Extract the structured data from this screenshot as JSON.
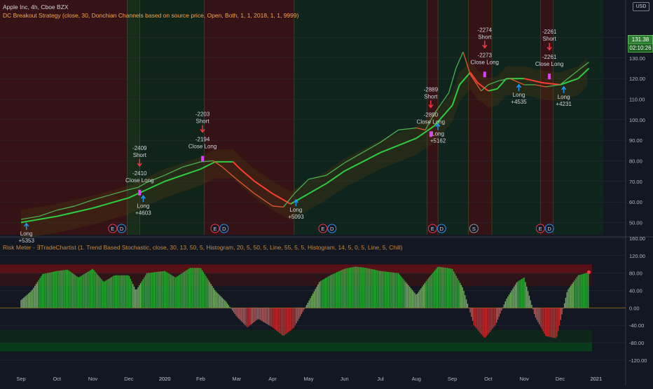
{
  "header": {
    "title": "Apple Inc, 4h, Cboe BZX",
    "strategy": "DC Breakout Strategy (close, 30, Donchian Channels based on source price, Open, Both, 1, 1, 2018, 1, 1, 9999)",
    "indicator": "Risk Meter - ∃TradeChartist (1. Trend Based Stochastic, close, 30, 13, 50, 5, Histogram, 20, 5, 50, 5, Line, 55, 5, 5, Histogram, 14, 5, 0, 5, Line, 5, Chill)",
    "currency": "USD",
    "last_price": "131.38",
    "countdown": "02:10:26"
  },
  "colors": {
    "background": "#131722",
    "bull_price": "#4caf50",
    "bear_price": "#e0582f",
    "channel_bull": "#2ecc40",
    "channel_bear": "#ff3b30",
    "long_arrow": "#2196f3",
    "short_arrow": "#f23645",
    "close_marker": "#e040fb",
    "accent_text": "#f7a543"
  },
  "chart_data": [
    {
      "type": "line",
      "title": "Apple Inc, 4h, Cboe BZX",
      "x_labels": [
        "Sep",
        "Oct",
        "Nov",
        "Dec",
        "2020",
        "Feb",
        "Mar",
        "Apr",
        "May",
        "Jun",
        "Jul",
        "Aug",
        "Sep",
        "Oct",
        "Nov",
        "Dec",
        "2021"
      ],
      "ylim": [
        44,
        148
      ],
      "yticks": [
        50,
        60,
        70,
        80,
        90,
        100,
        110,
        120,
        130,
        140
      ],
      "series": [
        {
          "key": "price",
          "x": [
            0,
            0.5,
            1,
            1.5,
            2,
            2.5,
            3,
            3.25,
            3.5,
            4,
            4.5,
            5,
            5.35,
            5.6,
            6,
            6.5,
            7,
            7.3,
            7.6,
            8,
            8.5,
            9,
            9.5,
            10,
            10.5,
            11,
            11.25,
            11.5,
            11.9,
            12.1,
            12.3,
            12.5,
            12.8,
            13,
            13.3,
            13.6,
            14,
            14.3,
            14.6,
            15,
            15.5,
            15.8
          ],
          "values": [
            51.5,
            53,
            56,
            58,
            61,
            63.5,
            66,
            67,
            69.5,
            73,
            77,
            79.5,
            80,
            77,
            71,
            64,
            58,
            57.5,
            64,
            71,
            73,
            79,
            84,
            89,
            95,
            96,
            95,
            103,
            113,
            125,
            133,
            122,
            114,
            117,
            119,
            120,
            117,
            117,
            116,
            117,
            124,
            128
          ]
        },
        {
          "key": "channel",
          "x": [
            0,
            1,
            2,
            3,
            3.5,
            4,
            5,
            5.4,
            5.9,
            6.1,
            6.5,
            7,
            7.5,
            8,
            8.5,
            9,
            10,
            11,
            11.5,
            12,
            12.2,
            12.5,
            12.7,
            13,
            13.25,
            13.5,
            14,
            14.5,
            15,
            15.5,
            15.8
          ],
          "values": [
            50,
            53,
            57,
            62,
            66,
            70,
            76,
            79.5,
            79.5,
            76,
            70,
            64,
            59,
            64,
            69,
            75,
            84,
            91,
            97,
            107,
            117,
            123,
            118,
            114,
            115,
            120,
            120,
            118,
            117,
            120,
            125
          ]
        }
      ],
      "trades": [
        {
          "kind": "long",
          "x": 0.15,
          "y": 49.5,
          "label": "Long",
          "value": "+5353"
        },
        {
          "kind": "close",
          "x": 3.3,
          "y": 64.5,
          "label": "-2410 Close Long",
          "short": "-2409 Short"
        },
        {
          "kind": "long",
          "x": 3.4,
          "y": 63,
          "label": "Long",
          "value": "+4603"
        },
        {
          "kind": "close",
          "x": 5.05,
          "y": 81,
          "label": "-2194 Close Long",
          "short": "-2203 Short"
        },
        {
          "kind": "long",
          "x": 7.65,
          "y": 61,
          "label": "Long",
          "value": "+5093"
        },
        {
          "kind": "close",
          "x": 11.4,
          "y": 93,
          "label": "-2890 Close Long",
          "short": "-2889 Short"
        },
        {
          "kind": "long",
          "x": 11.6,
          "y": 98,
          "label": "Long",
          "value": "+5162"
        },
        {
          "kind": "close",
          "x": 12.9,
          "y": 122,
          "label": "-2273 Close Long",
          "short": "-2274 Short"
        },
        {
          "kind": "long",
          "x": 13.85,
          "y": 117,
          "label": "Long",
          "value": "+4535"
        },
        {
          "kind": "close",
          "x": 14.7,
          "y": 121,
          "label": "-2261 Close Long",
          "short": "-2261 Short"
        },
        {
          "kind": "long",
          "x": 15.1,
          "y": 116,
          "label": "Long",
          "value": "+4231"
        }
      ],
      "events": [
        {
          "x": 2.55,
          "label": "E"
        },
        {
          "x": 2.8,
          "label": "D"
        },
        {
          "x": 5.4,
          "label": "E"
        },
        {
          "x": 5.65,
          "label": "D"
        },
        {
          "x": 8.4,
          "label": "E"
        },
        {
          "x": 8.65,
          "label": "D"
        },
        {
          "x": 11.45,
          "label": "E"
        },
        {
          "x": 11.7,
          "label": "D"
        },
        {
          "x": 12.6,
          "label": "S"
        },
        {
          "x": 14.45,
          "label": "E"
        },
        {
          "x": 14.7,
          "label": "D"
        }
      ]
    },
    {
      "type": "bar",
      "title": "Risk Meter",
      "ylim": [
        -130,
        160
      ],
      "yticks": [
        160,
        120,
        80,
        40,
        0,
        -40,
        -80,
        -120
      ],
      "ytick_labels": [
        "160.00",
        "120.00",
        "80.00",
        "40.00",
        "0.00",
        "-40.00",
        "-80.00",
        "-120.00"
      ],
      "last_value": "80.00",
      "x": [
        0,
        0.3,
        0.6,
        1,
        1.3,
        1.6,
        2,
        2.3,
        2.6,
        3,
        3.2,
        3.5,
        4,
        4.3,
        4.7,
        5,
        5.4,
        5.7,
        6,
        6.3,
        6.6,
        7,
        7.3,
        7.6,
        8,
        8.3,
        8.6,
        9,
        9.3,
        9.6,
        10,
        10.5,
        11,
        11.3,
        11.6,
        12,
        12.3,
        12.6,
        12.9,
        13.2,
        13.5,
        13.8,
        14,
        14.3,
        14.6,
        14.9,
        15.2,
        15.5,
        15.8
      ],
      "values": [
        18,
        40,
        78,
        85,
        88,
        70,
        90,
        60,
        75,
        75,
        40,
        80,
        85,
        70,
        92,
        92,
        40,
        15,
        -20,
        -45,
        -25,
        -45,
        -65,
        -45,
        15,
        60,
        75,
        90,
        95,
        92,
        85,
        80,
        30,
        65,
        95,
        90,
        45,
        -40,
        -70,
        -40,
        20,
        60,
        70,
        -20,
        -65,
        -70,
        40,
        75,
        82
      ]
    }
  ]
}
